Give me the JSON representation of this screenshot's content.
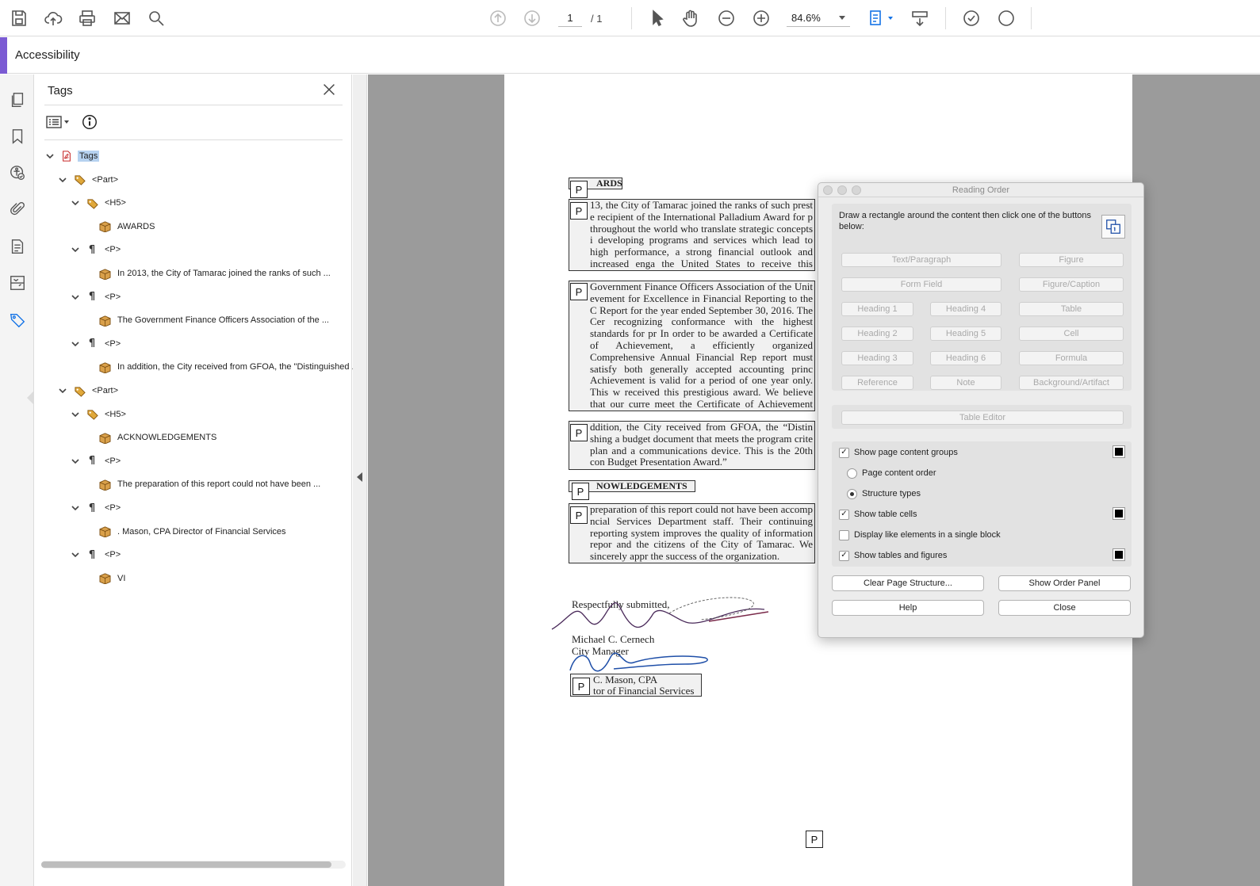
{
  "toolbar": {
    "current_page": "1",
    "page_total": "/ 1",
    "zoom": "84.6%"
  },
  "accessibility_bar": {
    "title": "Accessibility"
  },
  "tags_panel": {
    "title": "Tags",
    "tree": [
      {
        "label": "Tags",
        "icon": "pdf-icon",
        "depth": 0,
        "chevron": true,
        "selected": true
      },
      {
        "label": "<Part>",
        "icon": "tag-icon",
        "depth": 1,
        "chevron": true
      },
      {
        "label": "<H5>",
        "icon": "tag-icon",
        "depth": 2,
        "chevron": true
      },
      {
        "label": "AWARDS",
        "icon": "content-box-icon",
        "depth": 3,
        "chevron": false
      },
      {
        "label": "<P>",
        "icon": "paragraph-icon",
        "depth": 2,
        "chevron": true
      },
      {
        "label": "In 2013, the City of Tamarac joined the ranks of such ...",
        "icon": "content-box-icon",
        "depth": 3,
        "chevron": false
      },
      {
        "label": "<P>",
        "icon": "paragraph-icon",
        "depth": 2,
        "chevron": true
      },
      {
        "label": "The Government Finance Officers Association of the ...",
        "icon": "content-box-icon",
        "depth": 3,
        "chevron": false
      },
      {
        "label": "<P>",
        "icon": "paragraph-icon",
        "depth": 2,
        "chevron": true
      },
      {
        "label": "In addition, the City received from GFOA, the \"Distinguished .",
        "icon": "content-box-icon",
        "depth": 3,
        "chevron": false
      },
      {
        "label": "<Part>",
        "icon": "tag-icon",
        "depth": 1,
        "chevron": true
      },
      {
        "label": "<H5>",
        "icon": "tag-icon",
        "depth": 2,
        "chevron": true
      },
      {
        "label": "ACKNOWLEDGEMENTS",
        "icon": "content-box-icon",
        "depth": 3,
        "chevron": false
      },
      {
        "label": "<P>",
        "icon": "paragraph-icon",
        "depth": 2,
        "chevron": true
      },
      {
        "label": "The preparation of this report could not have been ...",
        "icon": "content-box-icon",
        "depth": 3,
        "chevron": false
      },
      {
        "label": "<P>",
        "icon": "paragraph-icon",
        "depth": 2,
        "chevron": true
      },
      {
        "label": ". Mason, CPA Director of Financial Services",
        "icon": "content-box-icon",
        "depth": 3,
        "chevron": false
      },
      {
        "label": "<P>",
        "icon": "paragraph-icon",
        "depth": 2,
        "chevron": true
      },
      {
        "label": "VI",
        "icon": "content-box-icon",
        "depth": 3,
        "chevron": false
      }
    ]
  },
  "document": {
    "ptag_label": "P",
    "heading_awards": "ARDS",
    "para1": "13, the City of Tamarac joined the ranks of such prest e recipient of the International Palladium Award for p throughout the world who translate strategic concepts i developing programs and services which lead to high performance, a strong financial outlook and increased enga the United States to receive this award.",
    "para2": "Government Finance Officers Association of the Unit evement for Excellence in Financial Reporting to the C Report for the year ended September 30, 2016. The Cer recognizing conformance with the highest standards for pr In order to be awarded a Certificate of Achievement, a efficiently organized Comprehensive Annual Financial Rep report must satisfy both generally accepted accounting princ Achievement is valid for a period of one year only. This w received this prestigious award. We believe that our curre meet the Certificate of Achievement Program's requiremen eligibility for the certificate.",
    "para3": "ddition, the City received from GFOA, the “Distin shing a budget document that meets the program crite plan and a communications device. This is the 20th con Budget Presentation Award.”",
    "heading_ack": "NOWLEDGEMENTS",
    "para4": "preparation of this report could not have been accomp ncial Services Department staff. Their continuing reporting system improves the quality of information repor and the citizens of the City of Tamarac. We sincerely appr the success of the organization.",
    "sig_submitted": "Respectfully submitted,",
    "sig_name1": "Michael C. Cernech",
    "sig_title1": "City Manager",
    "sig_name2": "C. Mason, CPA",
    "sig_title2": "tor of Financial Services"
  },
  "reading_order": {
    "title": "Reading Order",
    "instructions": "Draw a rectangle around the content then click one of the buttons below:",
    "buttons": {
      "text_paragraph": "Text/Paragraph",
      "figure": "Figure",
      "form_field": "Form Field",
      "figure_caption": "Figure/Caption",
      "heading1": "Heading 1",
      "heading4": "Heading 4",
      "table": "Table",
      "heading2": "Heading 2",
      "heading5": "Heading 5",
      "cell": "Cell",
      "heading3": "Heading 3",
      "heading6": "Heading 6",
      "formula": "Formula",
      "reference": "Reference",
      "note": "Note",
      "background_artifact": "Background/Artifact",
      "table_editor": "Table Editor"
    },
    "options": {
      "show_page_content_groups": {
        "label": "Show page content groups",
        "checked": true
      },
      "page_content_order": {
        "label": "Page content order",
        "selected": false
      },
      "structure_types": {
        "label": "Structure types",
        "selected": true
      },
      "show_table_cells": {
        "label": "Show table cells",
        "checked": true
      },
      "display_like_elements": {
        "label": "Display like elements in a single block",
        "checked": false
      },
      "show_tables_and_figures": {
        "label": "Show tables and figures",
        "checked": true
      }
    },
    "actions": {
      "clear_page_structure": "Clear Page Structure...",
      "show_order_panel": "Show Order Panel",
      "help": "Help",
      "close": "Close"
    }
  },
  "colors": {
    "accent_purple": "#7b5bd3",
    "active_blue": "#1473e6",
    "selection": "#b6d2f0",
    "doc_background": "#9b9b9b",
    "signature_purple": "#4a2a5a",
    "signature_blue": "#1f4fa8"
  }
}
